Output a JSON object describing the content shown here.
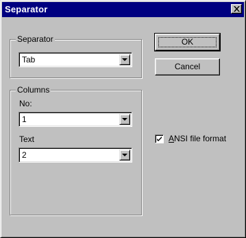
{
  "window": {
    "title": "Separator"
  },
  "separator_group": {
    "label": "Separator",
    "combo_value": "Tab"
  },
  "columns_group": {
    "label": "Columns",
    "no_label": "No:",
    "no_value": "1",
    "text_label": "Text",
    "text_value": "2"
  },
  "buttons": {
    "ok_label": "OK",
    "cancel_label": "Cancel"
  },
  "ansi": {
    "checked": true,
    "mnemonic": "A",
    "label_rest": "NSI file format"
  },
  "icons": {
    "close": "close-icon",
    "dropdown": "chevron-down-icon",
    "check": "checkmark-icon"
  }
}
